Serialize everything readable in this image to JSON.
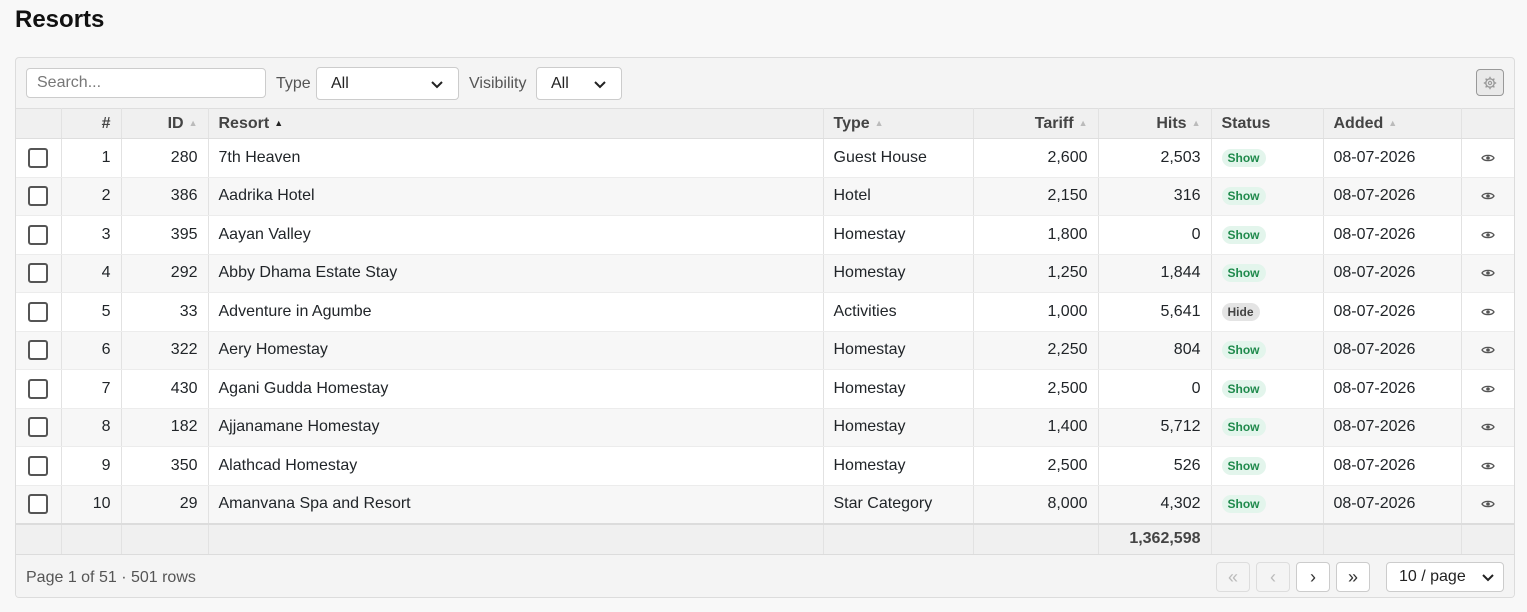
{
  "title": "Resorts",
  "search": {
    "placeholder": "Search...",
    "value": ""
  },
  "filters": [
    {
      "label": "Type",
      "value": "All"
    },
    {
      "label": "Visibility",
      "value": "All"
    }
  ],
  "columns": {
    "num": "#",
    "id": "ID",
    "resort": "Resort",
    "type": "Type",
    "tariff": "Tariff",
    "hits": "Hits",
    "status": "Status",
    "added": "Added"
  },
  "rows": [
    {
      "num": "1",
      "id": "280",
      "resort": "7th Heaven",
      "type": "Guest House",
      "tariff": "2,600",
      "hits": "2,503",
      "status": "Show",
      "added": "08-07-2026"
    },
    {
      "num": "2",
      "id": "386",
      "resort": "Aadrika Hotel",
      "type": "Hotel",
      "tariff": "2,150",
      "hits": "316",
      "status": "Show",
      "added": "08-07-2026"
    },
    {
      "num": "3",
      "id": "395",
      "resort": "Aayan Valley",
      "type": "Homestay",
      "tariff": "1,800",
      "hits": "0",
      "status": "Show",
      "added": "08-07-2026"
    },
    {
      "num": "4",
      "id": "292",
      "resort": "Abby Dhama Estate Stay",
      "type": "Homestay",
      "tariff": "1,250",
      "hits": "1,844",
      "status": "Show",
      "added": "08-07-2026"
    },
    {
      "num": "5",
      "id": "33",
      "resort": "Adventure in Agumbe",
      "type": "Activities",
      "tariff": "1,000",
      "hits": "5,641",
      "status": "Hide",
      "added": "08-07-2026"
    },
    {
      "num": "6",
      "id": "322",
      "resort": "Aery Homestay",
      "type": "Homestay",
      "tariff": "2,250",
      "hits": "804",
      "status": "Show",
      "added": "08-07-2026"
    },
    {
      "num": "7",
      "id": "430",
      "resort": "Agani Gudda Homestay",
      "type": "Homestay",
      "tariff": "2,500",
      "hits": "0",
      "status": "Show",
      "added": "08-07-2026"
    },
    {
      "num": "8",
      "id": "182",
      "resort": "Ajjanamane Homestay",
      "type": "Homestay",
      "tariff": "1,400",
      "hits": "5,712",
      "status": "Show",
      "added": "08-07-2026"
    },
    {
      "num": "9",
      "id": "350",
      "resort": "Alathcad Homestay",
      "type": "Homestay",
      "tariff": "2,500",
      "hits": "526",
      "status": "Show",
      "added": "08-07-2026"
    },
    {
      "num": "10",
      "id": "29",
      "resort": "Amanvana Spa and Resort",
      "type": "Star Category",
      "tariff": "8,000",
      "hits": "4,302",
      "status": "Show",
      "added": "08-07-2026"
    }
  ],
  "totals": {
    "hits": "1,362,598"
  },
  "pagination": {
    "info": "Page 1 of 51 · 501 rows",
    "first": "«",
    "prev": "‹",
    "next": "›",
    "last": "»",
    "page_size": "10 / page"
  },
  "icons": {
    "settings": "gear-icon",
    "view": "eye-icon",
    "select_arrow": "chevron-down-icon",
    "sort_asc": "sort-asc-icon",
    "sort_neutral": "sort-neutral-icon"
  },
  "colors": {
    "show_badge_bg": "#e3f5ec",
    "show_badge_text": "#1f8a4c",
    "hide_badge_bg": "#e4e4e4",
    "hide_badge_text": "#444444"
  }
}
